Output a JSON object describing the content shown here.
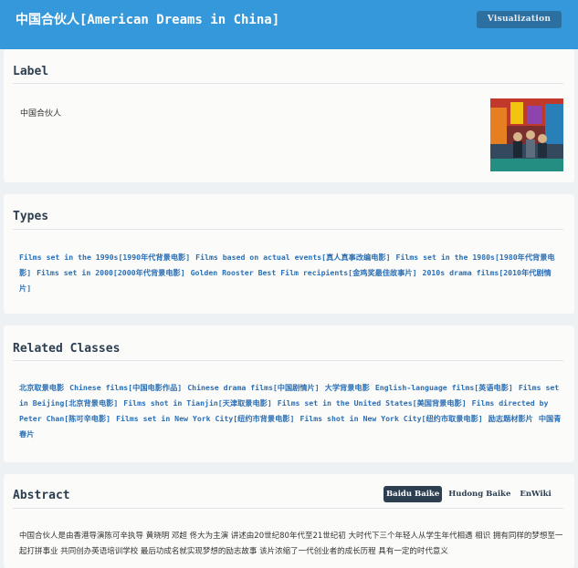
{
  "header": {
    "title": "中国合伙人[American Dreams in China]",
    "viz_button": "Visualization"
  },
  "label_section": {
    "heading": "Label",
    "text": "中国合伙人",
    "thumbnail": "movie-poster-image"
  },
  "types_section": {
    "heading": "Types",
    "items": [
      "Films set in the 1990s[1990年代背景电影]",
      "Films based on actual events[真人真事改编电影]",
      "Films set in the 1980s[1980年代背景电影]",
      "Films set in 2000[2000年代背景电影]",
      "Golden Rooster Best Film recipients[金鸡奖最佳故事片]",
      "2010s drama films[2010年代剧情片]"
    ]
  },
  "related_section": {
    "heading": "Related Classes",
    "items": [
      "北京取景电影",
      "Chinese films[中国电影作品]",
      "Chinese drama films[中国剧情片]",
      "大学背景电影",
      "English-language films[英语电影]",
      "Films set in Beijing[北京背景电影]",
      "Films shot in Tianjin[天津取景电影]",
      "Films set in the United States[美国背景电影]",
      "Films directed by Peter Chan[陈可辛电影]",
      "Films set in New York City[纽约市背景电影]",
      "Films shot in New York City[纽约市取景电影]",
      "励志题材影片",
      "中国青春片"
    ]
  },
  "abstract_section": {
    "heading": "Abstract",
    "tabs": [
      "Baidu Baike",
      "Hudong Baike",
      "EnWiki"
    ],
    "active_tab": "Baidu Baike",
    "text": "中国合伙人是由香港导演陈可辛执导 黄晓明 邓超 佟大为主演 讲述由20世纪80年代至21世纪初 大时代下三个年轻人从学生年代相遇 相识 拥有同样的梦想至一起打拼事业 共同创办英语培训学校 最后功成名就实现梦想的励志故事 该片浓缩了一代创业者的成长历程 具有一定的时代意义"
  },
  "colors": {
    "header_bg": "#3498db",
    "link": "#2a6fb5",
    "heading": "#2c3e50",
    "page_bg": "#eef1f4",
    "card_bg": "#fbfbf9"
  }
}
